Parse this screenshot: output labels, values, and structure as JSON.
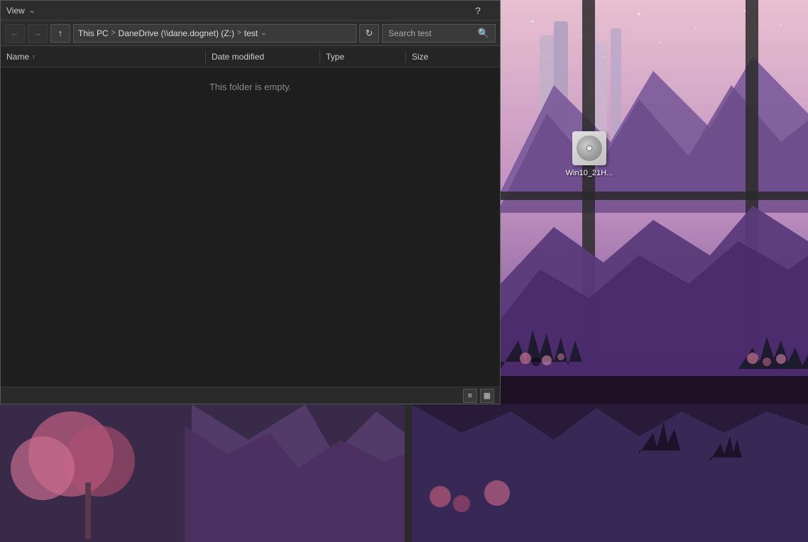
{
  "titlebar": {
    "title": "View",
    "help_btn": "?",
    "chevron_btn": "⌄"
  },
  "toolbar": {
    "back_btn": "←",
    "forward_btn": "→",
    "up_btn": "↑",
    "refresh_btn": "↻",
    "breadcrumb": {
      "this_pc": "This PC",
      "sep1": ">",
      "danedrive": "DaneDrive (\\\\dane.dognet) (Z:)",
      "sep2": ">",
      "folder": "test",
      "chevron": "⌄"
    },
    "search_placeholder": "Search test",
    "search_icon": "🔍"
  },
  "columns": {
    "name": {
      "label": "Name",
      "sort_indicator": "↑"
    },
    "date_modified": {
      "label": "Date modified"
    },
    "type": {
      "label": "Type"
    },
    "size": {
      "label": "Size"
    }
  },
  "file_list": {
    "empty_message": "This folder is empty."
  },
  "status_bar": {
    "icon1": "≡",
    "icon2": "▦"
  },
  "desktop_icon": {
    "label": "Win10_21H...",
    "disc_alt": "ISO disc image"
  },
  "colors": {
    "bg": "#1e1e1e",
    "titlebar": "#2d2d2d",
    "text": "#ddd",
    "muted": "#888"
  }
}
